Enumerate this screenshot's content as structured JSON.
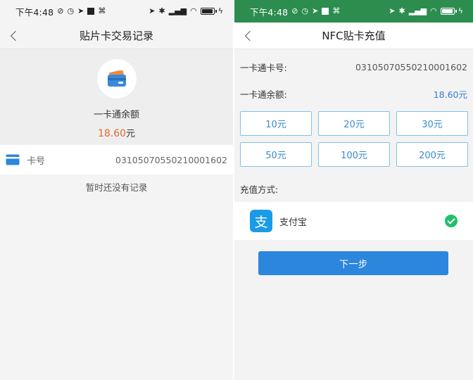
{
  "left": {
    "statusbar": {
      "time": "下午4:48",
      "icons": [
        "notification-off-icon",
        "alarm-icon",
        "location-arrow-icon",
        "square-icon",
        "app-icon",
        "location-arrow-icon",
        "bluetooth-icon",
        "signal-icon",
        "wifi-icon",
        "battery-icon",
        "charging-icon"
      ]
    },
    "navbar": {
      "title": "贴片卡交易记录"
    },
    "balance": {
      "label": "一卡通余额",
      "amount": "18.60",
      "unit": "元",
      "amount_color": "#e0692f"
    },
    "card_row": {
      "label": "卡号",
      "number": "03105070550210001602"
    },
    "empty_text": "暂时还没有记录"
  },
  "right": {
    "statusbar": {
      "time": "下午4:48",
      "bg_color": "#2c8d4e"
    },
    "navbar": {
      "title": "NFC贴卡充值"
    },
    "card_number": {
      "label": "一卡通卡号:",
      "value": "03105070550210001602"
    },
    "balance": {
      "label": "一卡通余额:",
      "value": "18.60元"
    },
    "amounts": [
      "10元",
      "20元",
      "30元",
      "50元",
      "100元",
      "200元"
    ],
    "pay_method_label": "充值方式:",
    "payment": {
      "logo_char": "支",
      "name": "支付宝",
      "selected": true
    },
    "next_button": "下一步",
    "accent_color": "#2b86dc"
  }
}
